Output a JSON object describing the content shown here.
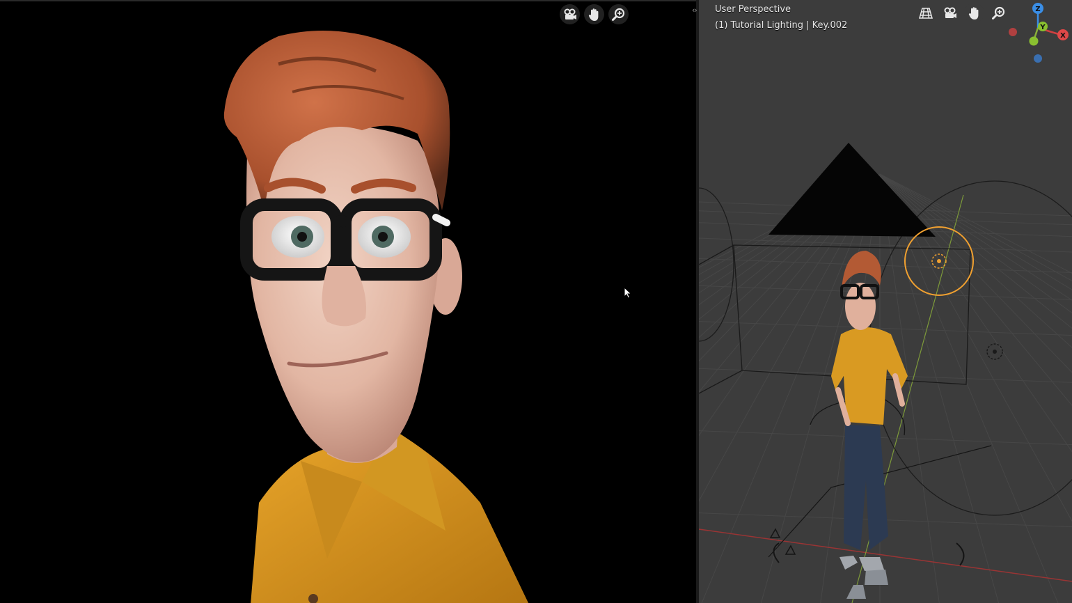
{
  "viewport_right": {
    "view_name": "User Perspective",
    "object_info": "(1) Tutorial Lighting | Key.002"
  },
  "toolbar_left": {
    "icons": [
      "camera-icon",
      "hand-pan-icon",
      "zoom-icon"
    ]
  },
  "toolbar_right": {
    "icons": [
      "grid-perspective-icon",
      "camera-icon",
      "hand-pan-icon",
      "zoom-icon"
    ]
  },
  "gizmo": {
    "z_label": "Z",
    "y_label": "Y",
    "x_label": "X"
  },
  "splitter": {
    "arrows": "‹›"
  },
  "colors": {
    "viewport_bg": "#3c3c3c",
    "grid_line": "#4a4a4a",
    "x_axis": "#b03a3a",
    "y_axis": "#8ab03a",
    "z_axis": "#3a8ee6",
    "shirt": "#d99a22",
    "hair": "#b35a34",
    "light_ring": "#f0a030"
  }
}
